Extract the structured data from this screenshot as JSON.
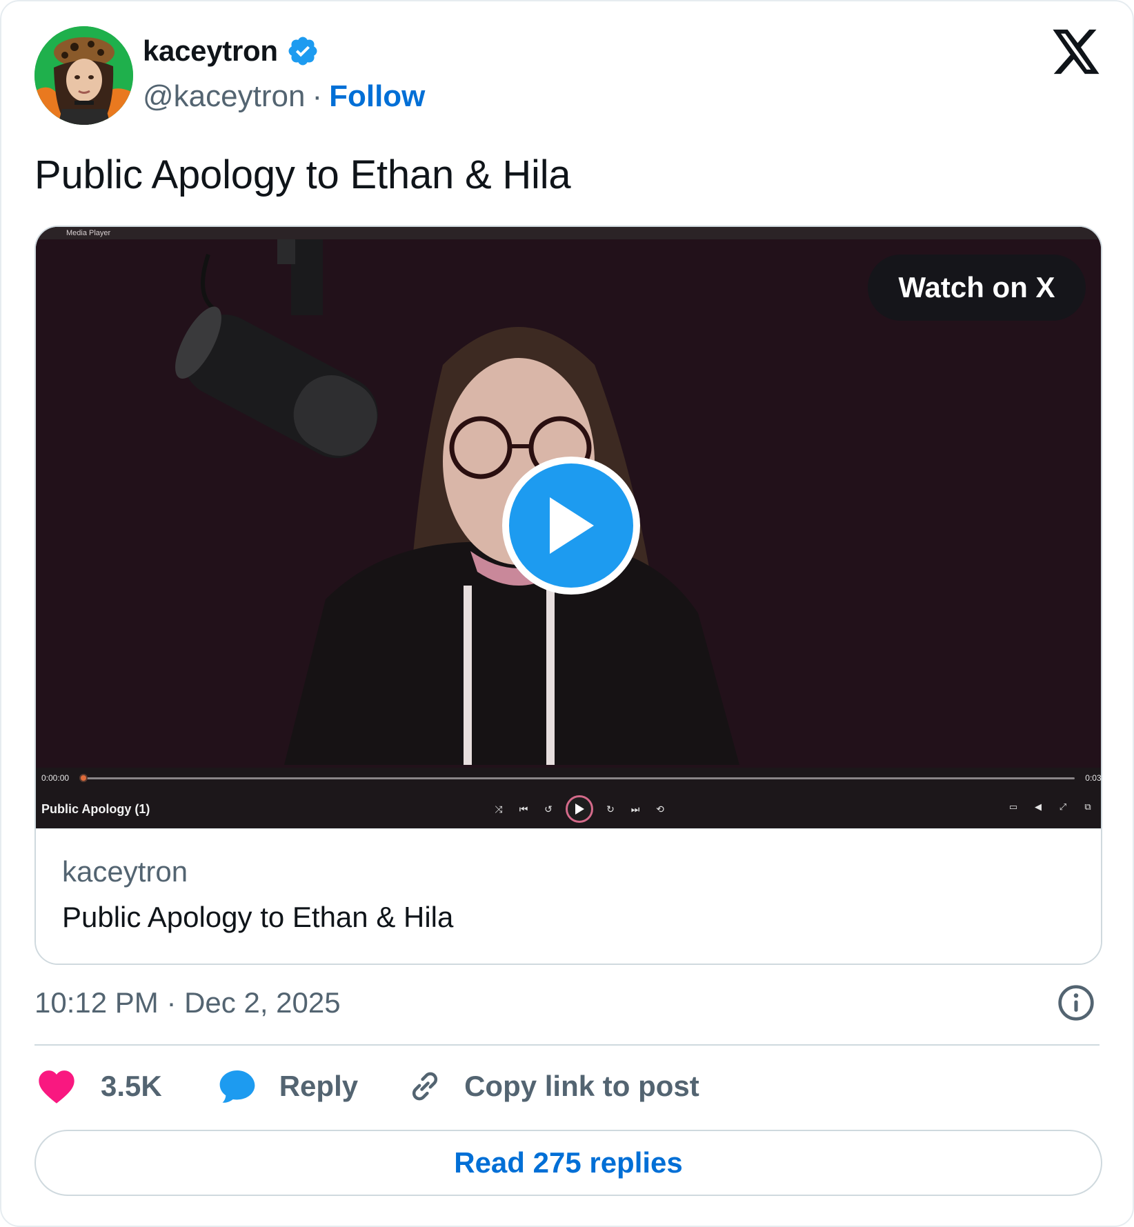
{
  "author": {
    "display_name": "kaceytron",
    "handle": "@kaceytron",
    "separator": "·",
    "follow_label": "Follow",
    "verified": true
  },
  "post": {
    "text": "Public Apology to Ethan & Hila",
    "timestamp": "10:12 PM · Dec 2, 2025"
  },
  "media": {
    "watch_label": "Watch on X",
    "player_window_title": "Media Player",
    "time_start": "0:00:00",
    "time_end": "0:03:",
    "clip_title": "Public Apology (1)",
    "progress_fraction": 0.0
  },
  "link_card": {
    "author": "kaceytron",
    "title": "Public Apology to Ethan & Hila"
  },
  "actions": {
    "likes_count": "3.5K",
    "reply_label": "Reply",
    "copy_link_label": "Copy link to post"
  },
  "footer": {
    "read_replies_label": "Read 275 replies"
  },
  "colors": {
    "accent_blue": "#1d9bf0",
    "link_blue": "#006fd6",
    "heart_pink": "#f91880",
    "muted_text": "#536471",
    "video_bg": "#22111a"
  },
  "icons": {
    "verified": "verified-badge-icon",
    "x_logo": "x-logo-icon",
    "play": "play-icon",
    "info": "info-icon",
    "heart": "heart-icon",
    "reply": "speech-bubble-icon",
    "link": "link-icon"
  }
}
